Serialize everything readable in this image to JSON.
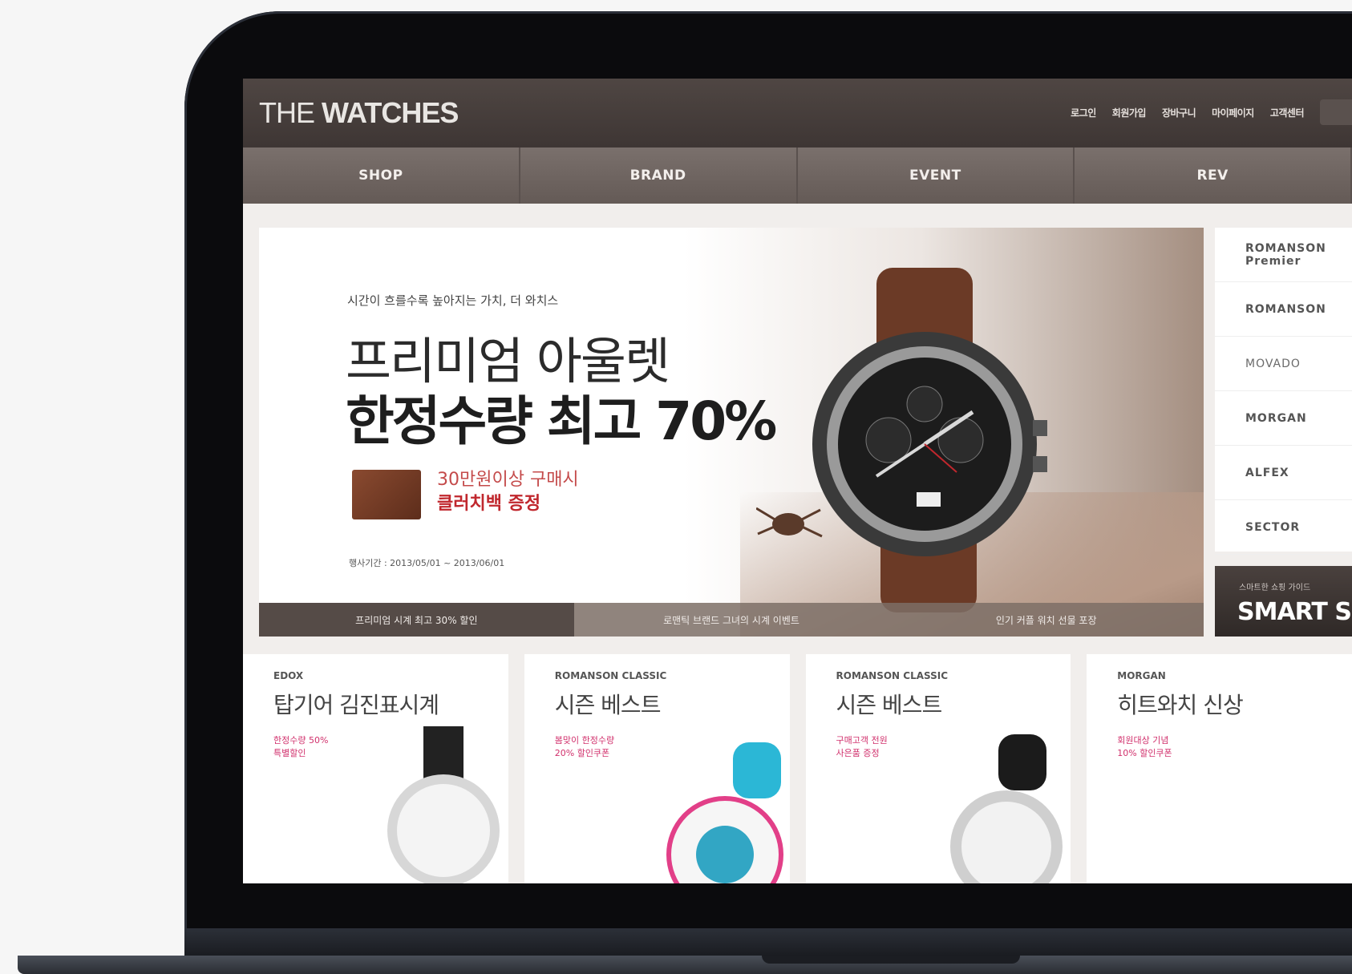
{
  "site": {
    "logo_prefix": "THE ",
    "logo_bold": "WATCHES",
    "top_links": [
      "로그인",
      "회원가입",
      "장바구니",
      "마이페이지",
      "고객센터"
    ],
    "nav": [
      "SHOP",
      "BRAND",
      "EVENT",
      "REV"
    ]
  },
  "hero": {
    "kicker": "시간이 흐를수록 높아지는 가치, 더 와치스",
    "title_line1": "프리미엄 아울렛",
    "title_line2": "한정수량 최고 70%",
    "offer_line1": "30만원이상 구매시",
    "offer_line2": "클러치백 증정",
    "period": "행사기간 : 2013/05/01 ~ 2013/06/01",
    "tabs": [
      "프리미엄 시계 최고 30% 할인",
      "로맨틱 브랜드 그녀의 시계 이벤트",
      "인기 커플 워치 선물 포장"
    ]
  },
  "brands": [
    "ROMANSON Premier",
    "ROMANSON",
    "MOVADO",
    "MORGAN",
    "ALFEX",
    "SECTOR"
  ],
  "smart_banner": {
    "kicker": "스마트한 쇼핑 가이드",
    "text": "SMART S"
  },
  "cards": [
    {
      "brand": "EDOX",
      "title": "탑기어 김진표시계",
      "promo": "한정수량 50%\n특별할인"
    },
    {
      "brand": "ROMANSON CLASSIC",
      "title": "시즌 베스트",
      "promo": "봄맞이 한정수량\n20% 할인쿠폰"
    },
    {
      "brand": "ROMANSON CLASSIC",
      "title": "시즌 베스트",
      "promo": "구매고객 전원\n사은품 증정"
    },
    {
      "brand": "MORGAN",
      "title": "히트와치 신상",
      "promo": "회원대상 기념\n10% 할인쿠폰"
    }
  ],
  "colors": {
    "topbar": "#4a403d",
    "nav": "#6e6460",
    "accent_red": "#c0272d",
    "promo_pink": "#d1306c"
  }
}
